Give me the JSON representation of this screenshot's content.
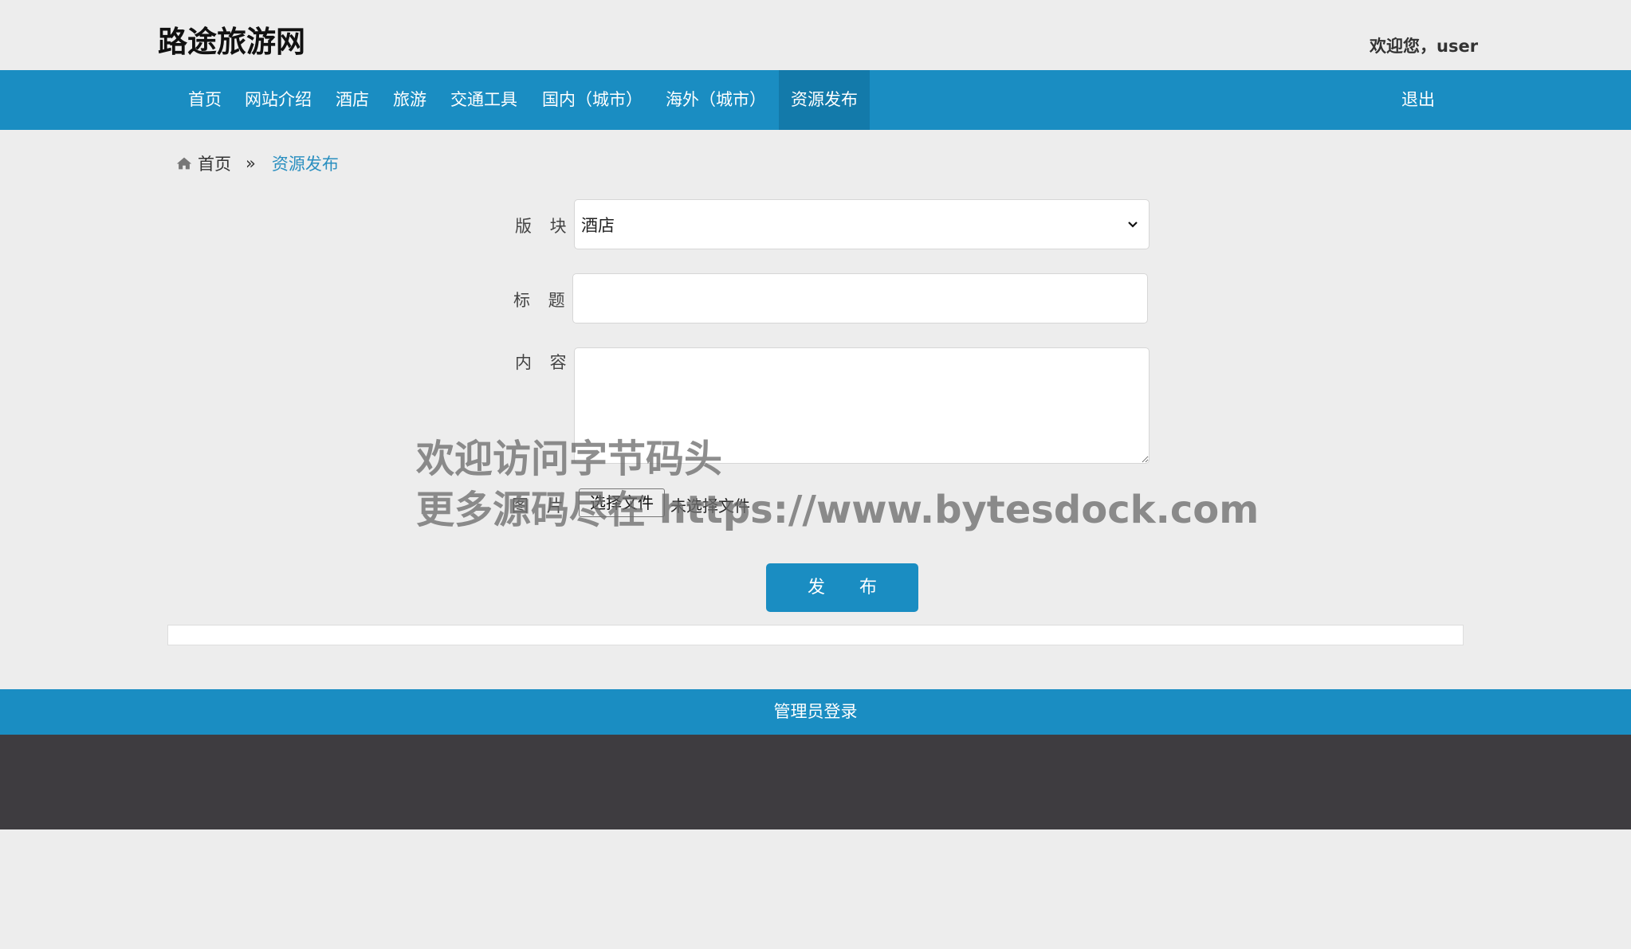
{
  "header": {
    "logo": "路途旅游网",
    "welcome": "欢迎您，user"
  },
  "nav": {
    "items": [
      {
        "label": "首页"
      },
      {
        "label": "网站介绍"
      },
      {
        "label": "酒店"
      },
      {
        "label": "旅游"
      },
      {
        "label": "交通工具"
      },
      {
        "label": "国内（城市）"
      },
      {
        "label": "海外（城市）"
      },
      {
        "label": "资源发布",
        "active": true
      }
    ],
    "logout": "退出"
  },
  "breadcrumb": {
    "home": "首页",
    "separator": "»",
    "current": "资源发布"
  },
  "form": {
    "section_label": "版 块",
    "section_value": "酒店",
    "title_label": "标 题",
    "title_value": "",
    "content_label": "内 容",
    "content_value": "",
    "image_label": "图 片",
    "file_button": "选择文件",
    "file_status": "未选择文件",
    "submit": "发 布"
  },
  "footer": {
    "admin_login": "管理员登录"
  },
  "watermark": {
    "line1": "欢迎访问字节码头",
    "line2": "更多源码尽在 https://www.bytesdock.com"
  },
  "colors": {
    "primary": "#1a8dc2",
    "nav_active": "#137aaa",
    "footer_dark": "#3e3c40",
    "background": "#ededed",
    "breadcrumb_current": "#2a8fc0"
  },
  "icons": {
    "breadcrumb_home": "home-icon",
    "select_caret": "chevron-down-icon"
  }
}
